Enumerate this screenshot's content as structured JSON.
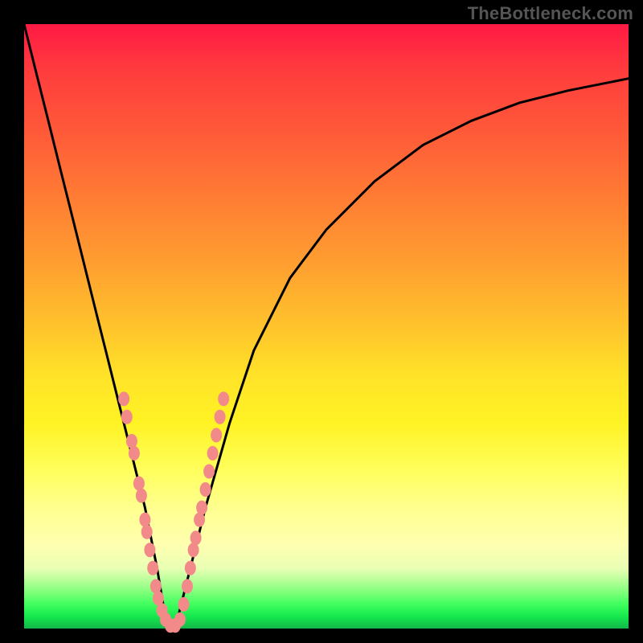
{
  "watermark": "TheBottleneck.com",
  "background_gradient_stops": [
    {
      "pos": 0.0,
      "color": "#ff1a44"
    },
    {
      "pos": 0.5,
      "color": "#ffc32c"
    },
    {
      "pos": 0.8,
      "color": "#ffff8f"
    },
    {
      "pos": 0.92,
      "color": "#b8ff9a"
    },
    {
      "pos": 1.0,
      "color": "#12b84a"
    }
  ],
  "chart_data": {
    "type": "line",
    "title": "",
    "xlabel": "",
    "ylabel": "",
    "xlim": [
      0,
      100
    ],
    "ylim": [
      0,
      100
    ],
    "grid": false,
    "legend": false,
    "series": [
      {
        "name": "bottleneck-curve",
        "color": "#000000",
        "x": [
          0,
          2,
          4,
          6,
          8,
          10,
          12,
          14,
          16,
          18,
          20,
          22,
          23,
          24,
          25,
          26,
          28,
          30,
          34,
          38,
          44,
          50,
          58,
          66,
          74,
          82,
          90,
          100
        ],
        "y": [
          100,
          92,
          84,
          76,
          68,
          60,
          52,
          44,
          36,
          28,
          20,
          10,
          4,
          0,
          0,
          4,
          12,
          20,
          34,
          46,
          58,
          66,
          74,
          80,
          84,
          87,
          89,
          91
        ]
      }
    ],
    "annotations": [
      {
        "name": "markers-left",
        "style": "pink-beads",
        "color": "#f28a8a",
        "points": [
          {
            "x": 16.5,
            "y": 38
          },
          {
            "x": 17.0,
            "y": 35
          },
          {
            "x": 17.8,
            "y": 31
          },
          {
            "x": 18.2,
            "y": 29
          },
          {
            "x": 19.0,
            "y": 24
          },
          {
            "x": 19.4,
            "y": 22
          },
          {
            "x": 20.0,
            "y": 18
          },
          {
            "x": 20.3,
            "y": 16
          },
          {
            "x": 20.8,
            "y": 13
          },
          {
            "x": 21.3,
            "y": 10
          },
          {
            "x": 21.8,
            "y": 7
          },
          {
            "x": 22.2,
            "y": 5
          },
          {
            "x": 22.8,
            "y": 3
          },
          {
            "x": 23.4,
            "y": 1.5
          },
          {
            "x": 24.2,
            "y": 0.5
          },
          {
            "x": 25.0,
            "y": 0.5
          }
        ]
      },
      {
        "name": "markers-right",
        "style": "pink-beads",
        "color": "#f28a8a",
        "points": [
          {
            "x": 25.8,
            "y": 1.5
          },
          {
            "x": 26.4,
            "y": 4
          },
          {
            "x": 27.0,
            "y": 7
          },
          {
            "x": 27.5,
            "y": 10
          },
          {
            "x": 28.0,
            "y": 13
          },
          {
            "x": 28.4,
            "y": 15
          },
          {
            "x": 29.0,
            "y": 18
          },
          {
            "x": 29.4,
            "y": 20
          },
          {
            "x": 30.0,
            "y": 23
          },
          {
            "x": 30.6,
            "y": 26
          },
          {
            "x": 31.2,
            "y": 29
          },
          {
            "x": 31.8,
            "y": 32
          },
          {
            "x": 32.4,
            "y": 35
          },
          {
            "x": 33.0,
            "y": 38
          }
        ]
      }
    ]
  }
}
